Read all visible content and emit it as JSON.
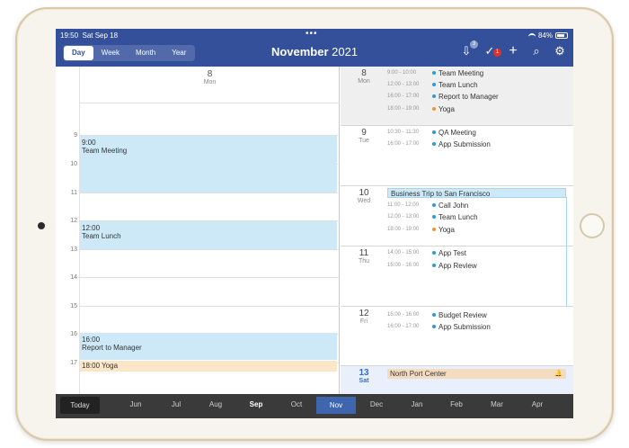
{
  "status": {
    "time": "19:50",
    "date": "Sat Sep 18",
    "battery": "84%"
  },
  "view_tabs": [
    "Day",
    "Week",
    "Month",
    "Year"
  ],
  "active_tab": "Day",
  "header": {
    "month": "November",
    "year": "2021",
    "inbox_badge": "3",
    "tasks_badge": "1"
  },
  "day_view": {
    "day_number": "8",
    "day_name": "Mon",
    "hours": [
      "9",
      "10",
      "11",
      "12",
      "13",
      "14",
      "15",
      "16",
      "17"
    ],
    "events": [
      {
        "time": "9:00",
        "title": "Team Meeting"
      },
      {
        "time": "12:00",
        "title": "Team Lunch"
      },
      {
        "time": "16:00",
        "title": "Report to Manager"
      },
      {
        "label": "18:00 Yoga"
      }
    ]
  },
  "agenda": {
    "days": [
      {
        "num": "8",
        "name": "Mon",
        "items": [
          {
            "time": "9:00 - 10:00",
            "title": "Team Meeting"
          },
          {
            "time": "12:00 - 13:00",
            "title": "Team Lunch"
          },
          {
            "time": "16:00 - 17:00",
            "title": "Report to Manager"
          },
          {
            "time": "18:00 - 19:00",
            "title": "Yoga"
          }
        ]
      },
      {
        "num": "9",
        "name": "Tue",
        "items": [
          {
            "time": "10:30 - 11:30",
            "title": "QA Meeting"
          },
          {
            "time": "16:00 - 17:00",
            "title": "App Submission"
          }
        ]
      },
      {
        "num": "10",
        "name": "Wed",
        "allday": "Business Trip to San Francisco",
        "items": [
          {
            "time": "11:00 - 12:00",
            "title": "Call John"
          },
          {
            "time": "12:00 - 13:00",
            "title": "Team Lunch"
          },
          {
            "time": "18:00 - 19:00",
            "title": "Yoga"
          }
        ]
      },
      {
        "num": "11",
        "name": "Thu",
        "items": [
          {
            "time": "14:00 - 15:00",
            "title": "App Test"
          },
          {
            "time": "15:00 - 16:00",
            "title": "App Review"
          }
        ]
      },
      {
        "num": "12",
        "name": "Fri",
        "items": [
          {
            "time": "15:00 - 16:00",
            "title": "Budget Review"
          },
          {
            "time": "16:00 - 17:00",
            "title": "App Submission"
          }
        ]
      },
      {
        "num": "13",
        "name": "Sat",
        "allday": "North Port Center",
        "items": []
      }
    ]
  },
  "bottom": {
    "today": "Today",
    "months": [
      "Jun",
      "Jul",
      "Aug",
      "Sep",
      "Oct",
      "Nov",
      "Dec",
      "Jan",
      "Feb",
      "Mar",
      "Apr"
    ],
    "bold_month": "Sep",
    "active_month": "Nov"
  },
  "colors": {
    "header": "#34509a",
    "event_blue": "#cde9f8",
    "event_orange": "#fbe6c8",
    "dot_blue": "#2b9bd8",
    "dot_orange": "#f0962c"
  }
}
